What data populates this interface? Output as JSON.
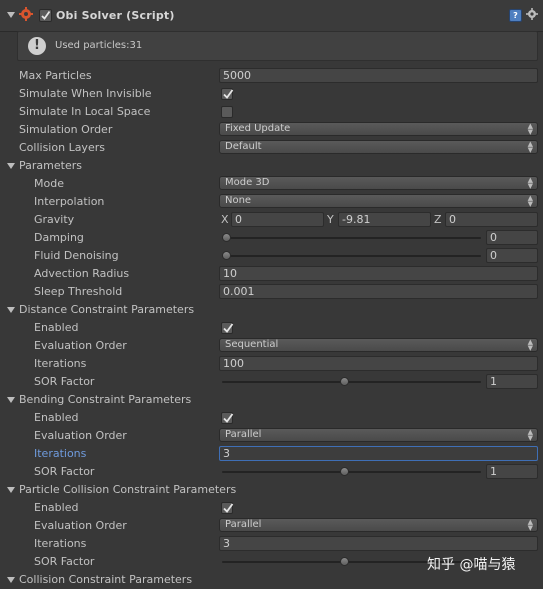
{
  "header": {
    "title": "Obi Solver (Script)"
  },
  "helpbox": {
    "text": "Used particles:31"
  },
  "fields": {
    "max_particles": {
      "label": "Max Particles",
      "value": "5000"
    },
    "simulate_when_invisible": {
      "label": "Simulate When Invisible",
      "checked": true
    },
    "simulate_local": {
      "label": "Simulate In Local Space",
      "checked": false
    },
    "simulation_order": {
      "label": "Simulation Order",
      "value": "Fixed Update"
    },
    "collision_layers": {
      "label": "Collision Layers",
      "value": "Default"
    }
  },
  "parameters": {
    "label": "Parameters",
    "mode": {
      "label": "Mode",
      "value": "Mode 3D"
    },
    "interpolation": {
      "label": "Interpolation",
      "value": "None"
    },
    "gravity": {
      "label": "Gravity",
      "x_label": "X",
      "x": "0",
      "y_label": "Y",
      "y": "-9.81",
      "z_label": "Z",
      "z": "0"
    },
    "damping": {
      "label": "Damping",
      "value": "0",
      "fraction": 0.0
    },
    "fluid_denoising": {
      "label": "Fluid Denoising",
      "value": "0",
      "fraction": 0.0
    },
    "advection_radius": {
      "label": "Advection Radius",
      "value": "10"
    },
    "sleep_threshold": {
      "label": "Sleep Threshold",
      "value": "0.001"
    }
  },
  "distance": {
    "label": "Distance Constraint Parameters",
    "enabled": {
      "label": "Enabled",
      "checked": true
    },
    "order": {
      "label": "Evaluation Order",
      "value": "Sequential"
    },
    "iterations": {
      "label": "Iterations",
      "value": "100"
    },
    "sor": {
      "label": "SOR Factor",
      "value": "1",
      "fraction": 0.47
    }
  },
  "bending": {
    "label": "Bending Constraint Parameters",
    "enabled": {
      "label": "Enabled",
      "checked": true
    },
    "order": {
      "label": "Evaluation Order",
      "value": "Parallel"
    },
    "iterations": {
      "label": "Iterations",
      "value": "3"
    },
    "sor": {
      "label": "SOR Factor",
      "value": "1",
      "fraction": 0.47
    }
  },
  "particle_collision": {
    "label": "Particle Collision Constraint Parameters",
    "enabled": {
      "label": "Enabled",
      "checked": true
    },
    "order": {
      "label": "Evaluation Order",
      "value": "Parallel"
    },
    "iterations": {
      "label": "Iterations",
      "value": "3"
    },
    "sor": {
      "label": "SOR Factor",
      "value": "1",
      "fraction": 0.47
    }
  },
  "collision": {
    "label": "Collision Constraint Parameters"
  },
  "watermark": "知乎 @喵与猿",
  "colors": {
    "background": "#383838",
    "field": "#454545",
    "focus": "#3f6fb6",
    "label_active": "#6f9bdd"
  }
}
